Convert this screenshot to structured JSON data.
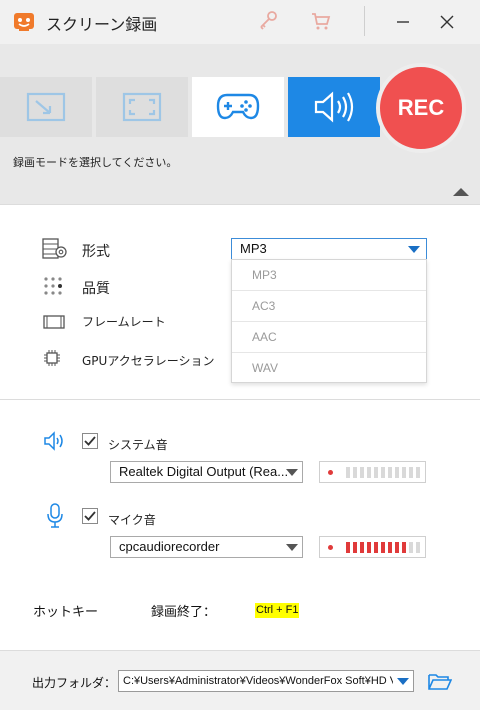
{
  "window": {
    "title": "スクリーン録画"
  },
  "modes": {
    "items": [
      {
        "name": "region",
        "icon": "region-capture-icon"
      },
      {
        "name": "fullscreen",
        "icon": "fullscreen-icon"
      },
      {
        "name": "game",
        "icon": "gamepad-icon"
      },
      {
        "name": "audio",
        "icon": "speaker-icon",
        "selected": true
      }
    ],
    "rec_label": "REC",
    "hint": "録画モードを選択してください。"
  },
  "video_settings": {
    "format_label": "形式",
    "format_value": "MP3",
    "quality_label": "品質",
    "framerate_label": "フレームレート",
    "gpu_label": "GPUアクセラレーション",
    "format_options": [
      "MP3",
      "AC3",
      "AAC",
      "WAV"
    ]
  },
  "audio_settings": {
    "system_sound": {
      "label": "システム音",
      "checked": true,
      "device": "Realtek Digital Output (Rea...",
      "level_active_bars": 0
    },
    "mic": {
      "label": "マイク音",
      "checked": true,
      "device": "cpcaudiorecorder",
      "level_active_bars": 9
    }
  },
  "hotkeys": {
    "section_label": "ホットキー",
    "action_label": "録画終了：",
    "combo": "Ctrl + F1"
  },
  "output": {
    "label": "出力フォルダ：",
    "path": "C:¥Users¥Administrator¥Videos¥WonderFox Soft¥HD Video Converter Factory Pro¥"
  },
  "colors": {
    "accent_blue": "#1e88e5",
    "rec_red": "#f05050",
    "meter_red": "#e03a3a",
    "meter_idle": "#d9d9d9",
    "hotkey_highlight": "#ffff00"
  }
}
